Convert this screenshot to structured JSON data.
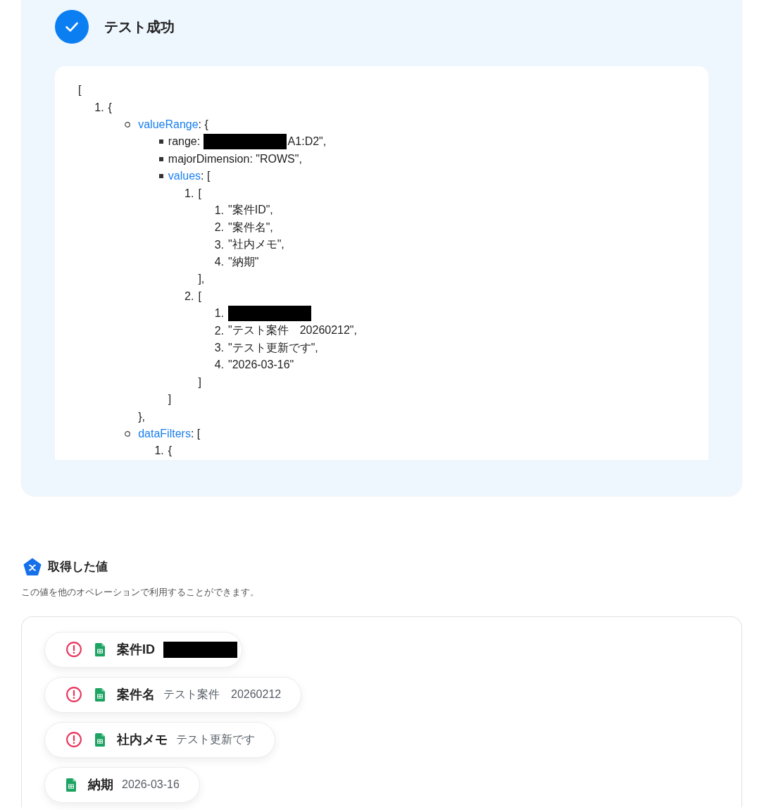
{
  "result": {
    "title": "テスト成功",
    "response": {
      "open": "[",
      "list": {
        "kind": "ordered",
        "items": [
          {
            "marker": "1.",
            "parts": [
              {
                "kind": "text",
                "text": "{"
              }
            ],
            "list": {
              "kind": "circle",
              "items": [
                {
                  "parts": [
                    {
                      "kind": "key",
                      "text": "valueRange"
                    },
                    {
                      "kind": "text",
                      "text": ": {"
                    }
                  ],
                  "list": {
                    "kind": "square",
                    "items": [
                      {
                        "parts": [
                          {
                            "kind": "text",
                            "text": "range: "
                          },
                          {
                            "kind": "redacted"
                          },
                          {
                            "kind": "text",
                            "text": "A1:D2\","
                          }
                        ]
                      },
                      {
                        "parts": [
                          {
                            "kind": "text",
                            "text": "majorDimension: \"ROWS\","
                          }
                        ]
                      },
                      {
                        "parts": [
                          {
                            "kind": "key",
                            "text": "values"
                          },
                          {
                            "kind": "text",
                            "text": ": ["
                          }
                        ],
                        "list": {
                          "kind": "ordered",
                          "items": [
                            {
                              "marker": "1.",
                              "parts": [
                                {
                                  "kind": "text",
                                  "text": "["
                                }
                              ],
                              "list": {
                                "kind": "ordered",
                                "items": [
                                  {
                                    "marker": "1.",
                                    "parts": [
                                      {
                                        "kind": "text",
                                        "text": "\"案件ID\","
                                      }
                                    ]
                                  },
                                  {
                                    "marker": "2.",
                                    "parts": [
                                      {
                                        "kind": "text",
                                        "text": "\"案件名\","
                                      }
                                    ]
                                  },
                                  {
                                    "marker": "3.",
                                    "parts": [
                                      {
                                        "kind": "text",
                                        "text": "\"社内メモ\","
                                      }
                                    ]
                                  },
                                  {
                                    "marker": "4.",
                                    "parts": [
                                      {
                                        "kind": "text",
                                        "text": "\"納期\""
                                      }
                                    ]
                                  }
                                ]
                              },
                              "close": "],"
                            },
                            {
                              "marker": "2.",
                              "parts": [
                                {
                                  "kind": "text",
                                  "text": "["
                                }
                              ],
                              "list": {
                                "kind": "ordered",
                                "items": [
                                  {
                                    "marker": "1.",
                                    "parts": [
                                      {
                                        "kind": "redacted"
                                      }
                                    ]
                                  },
                                  {
                                    "marker": "2.",
                                    "parts": [
                                      {
                                        "kind": "text",
                                        "text": "\"テスト案件　20260212\","
                                      }
                                    ]
                                  },
                                  {
                                    "marker": "3.",
                                    "parts": [
                                      {
                                        "kind": "text",
                                        "text": "\"テスト更新です\","
                                      }
                                    ]
                                  },
                                  {
                                    "marker": "4.",
                                    "parts": [
                                      {
                                        "kind": "text",
                                        "text": "\"2026-03-16\""
                                      }
                                    ]
                                  }
                                ]
                              },
                              "close": "]"
                            }
                          ]
                        },
                        "close": "]"
                      }
                    ]
                  },
                  "close": "},"
                },
                {
                  "parts": [
                    {
                      "kind": "key",
                      "text": "dataFilters"
                    },
                    {
                      "kind": "text",
                      "text": ": ["
                    }
                  ],
                  "list": {
                    "kind": "ordered",
                    "items": [
                      {
                        "marker": "1.",
                        "parts": [
                          {
                            "kind": "text",
                            "text": "{"
                          }
                        ]
                      }
                    ]
                  }
                }
              ]
            }
          }
        ]
      }
    }
  },
  "output": {
    "title": "取得した値",
    "description": "この値を他のオペレーションで利用することができます。",
    "values": [
      {
        "label": "案件ID",
        "warning": true,
        "redacted": true
      },
      {
        "label": "案件名",
        "value": "テスト案件　20260212",
        "warning": true,
        "redacted": false
      },
      {
        "label": "社内メモ",
        "value": "テスト更新です",
        "warning": true,
        "redacted": false
      },
      {
        "label": "納期",
        "value": "2026-03-16",
        "warning": false,
        "redacted": false
      }
    ]
  }
}
